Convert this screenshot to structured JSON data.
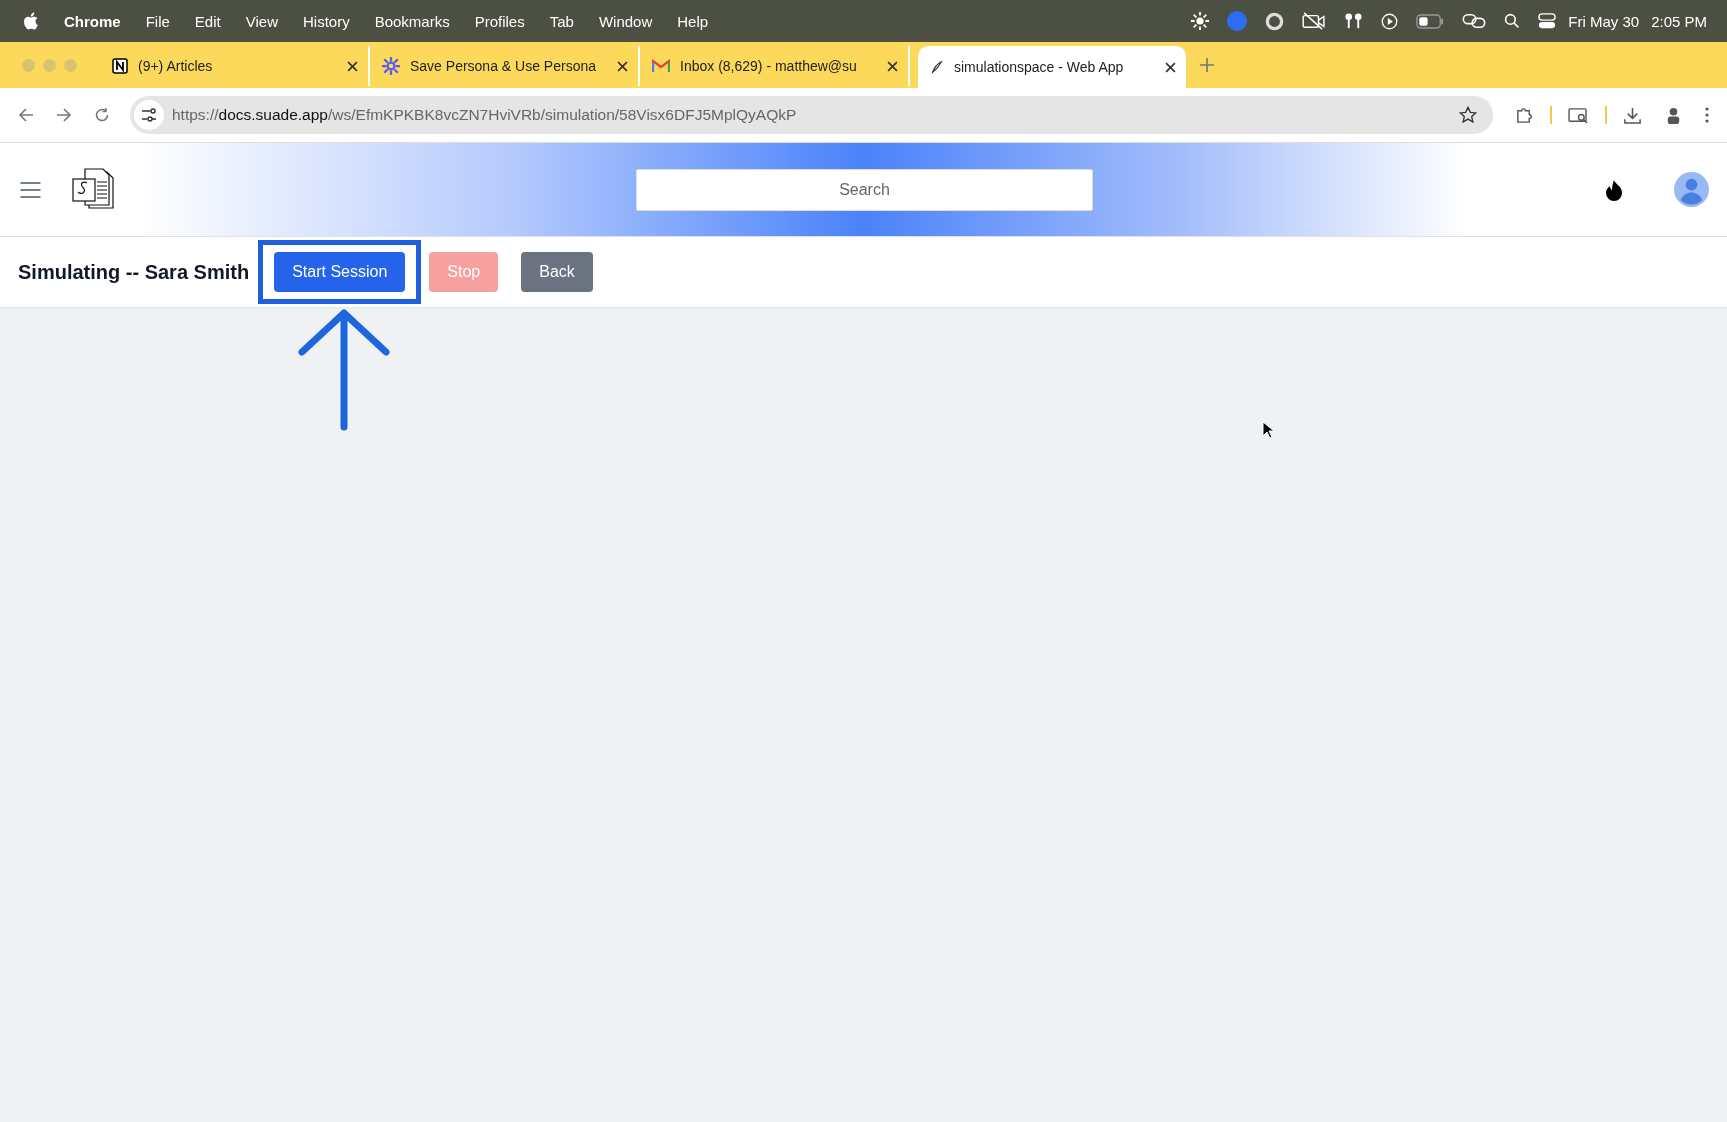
{
  "menubar": {
    "app": "Chrome",
    "items": [
      "File",
      "Edit",
      "View",
      "History",
      "Bookmarks",
      "Profiles",
      "Tab",
      "Window",
      "Help"
    ],
    "date": "Fri May 30",
    "time": "2:05 PM"
  },
  "browser": {
    "tabs": [
      {
        "title": "(9+) Articles",
        "selected": false
      },
      {
        "title": "Save Persona & Use Persona",
        "selected": false
      },
      {
        "title": "Inbox (8,629) - matthew@su",
        "selected": false
      },
      {
        "title": "simulationspace - Web App",
        "selected": true
      }
    ],
    "url": {
      "scheme": "https://",
      "host": "docs.suade.app",
      "path": "/ws/EfmKPKBK8vcZN7HviVRb/simulation/58Visx6DFJ5MplQyAQkP"
    }
  },
  "header": {
    "search": {
      "placeholder": "Search"
    }
  },
  "toolbar": {
    "title": "Simulating -- Sara Smith",
    "buttons": [
      {
        "label": "Start Session",
        "kind": "primary",
        "disabled": false,
        "highlighted": true
      },
      {
        "label": "Stop",
        "kind": "danger",
        "disabled": true,
        "highlighted": false
      },
      {
        "label": "Back",
        "kind": "secondary",
        "disabled": false,
        "highlighted": false
      }
    ]
  }
}
